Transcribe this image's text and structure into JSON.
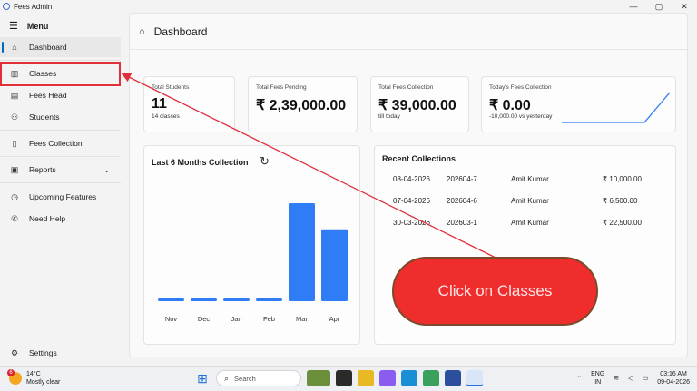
{
  "window": {
    "title": "Fees Admin",
    "controls": [
      "—",
      "▢",
      "✕"
    ]
  },
  "sidebar": {
    "menu_label": "Menu",
    "items": [
      {
        "label": "Dashboard",
        "icon": "home-icon"
      },
      {
        "label": "Classes",
        "icon": "books-icon"
      },
      {
        "label": "Fees Head",
        "icon": "list-icon"
      },
      {
        "label": "Students",
        "icon": "people-icon"
      },
      {
        "label": "Fees Collection",
        "icon": "receipt-icon"
      },
      {
        "label": "Reports",
        "icon": "report-icon"
      },
      {
        "label": "Upcoming Features",
        "icon": "clock-icon"
      },
      {
        "label": "Need Help",
        "icon": "phone-icon"
      },
      {
        "label": "Settings",
        "icon": "gear-icon"
      }
    ]
  },
  "main": {
    "title": "Dashboard",
    "stats": [
      {
        "title": "Total Students",
        "value": "11",
        "sub": "14 classes"
      },
      {
        "title": "Total Fees Pending",
        "value": "₹ 2,39,000.00",
        "sub": ""
      },
      {
        "title": "Total Fees Collection",
        "value": "₹ 39,000.00",
        "sub": "till today"
      },
      {
        "title": "Today's Fees Collection",
        "value": "₹ 0.00",
        "sub": "-10,000.00 vs yesterday"
      }
    ],
    "recent": {
      "title": "Recent Collections",
      "rows": [
        {
          "date": "08-04-2026",
          "receipt": "202604-7",
          "name": "Amit Kumar",
          "amount": "₹ 10,000.00"
        },
        {
          "date": "07-04-2026",
          "receipt": "202604-6",
          "name": "Amit Kumar",
          "amount": "₹ 6,500.00"
        },
        {
          "date": "30-03-2026",
          "receipt": "202603-1",
          "name": "Amit Kumar",
          "amount": "₹ 22,500.00"
        }
      ]
    }
  },
  "chart_data": {
    "type": "bar",
    "title": "Last 6 Months Collection",
    "categories": [
      "Nov",
      "Dec",
      "Jan",
      "Feb",
      "Mar",
      "Apr"
    ],
    "values": [
      0,
      0,
      0,
      0,
      22500,
      16500
    ],
    "ylim": [
      0,
      22500
    ],
    "grid": false,
    "color": "#2f7df6"
  },
  "callout": {
    "text": "Click on Classes",
    "color": "#f02d2d"
  },
  "taskbar": {
    "weather_temp": "14°C",
    "weather_desc": "Mostly clear",
    "weather_badge": "6",
    "search_placeholder": "Search",
    "lang_top": "ENG",
    "lang_bottom": "IN",
    "time": "03:16 AM",
    "date": "09-04-2026"
  }
}
